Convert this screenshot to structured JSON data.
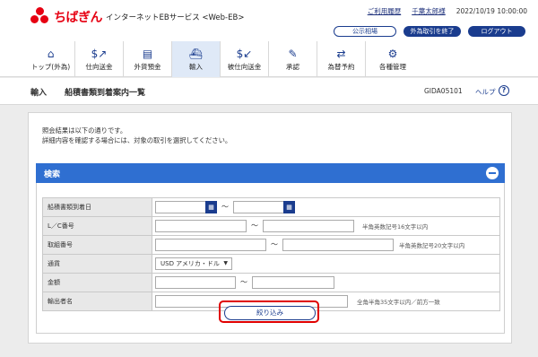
{
  "header": {
    "logo_text": "ちばぎん",
    "service_name": "インターネットEBサービス <Web-EB>",
    "usage_history_link": "ご利用履歴",
    "user_name": "千葉太郎様",
    "datetime": "2022/10/19 10:00:00",
    "buttons": {
      "public_rates": "公示相場",
      "end_fx": "外為取引を終了",
      "logout": "ログアウト"
    }
  },
  "nav": [
    {
      "label": "トップ(外為)",
      "icon": "home-icon"
    },
    {
      "label": "仕向送金",
      "icon": "remit-out-icon"
    },
    {
      "label": "外貨預金",
      "icon": "deposit-icon"
    },
    {
      "label": "輸入",
      "icon": "import-icon",
      "active": true
    },
    {
      "label": "被仕向送金",
      "icon": "remit-in-icon"
    },
    {
      "label": "承認",
      "icon": "approval-icon"
    },
    {
      "label": "為替予約",
      "icon": "fx-contract-icon"
    },
    {
      "label": "各種管理",
      "icon": "management-icon"
    }
  ],
  "title_bar": {
    "category": "輸入",
    "title": "船積書類到着案内一覧",
    "screen_code": "GIDA05101",
    "help": "ヘルプ",
    "help_icon": "?"
  },
  "message": {
    "line1": "照会結果は以下の通りです。",
    "line2": "詳細内容を確認する場合には、対象の取引を選択してください。"
  },
  "search": {
    "title": "検索",
    "fields": {
      "arrival_date": {
        "label": "船積書類到着日",
        "from": "",
        "to": "",
        "sep": "～"
      },
      "lc_number": {
        "label": "L／C番号",
        "from": "",
        "to": "",
        "sep": "～",
        "hint": "半角英数記号16文字以内"
      },
      "trade_number": {
        "label": "取組番号",
        "from": "",
        "to": "",
        "sep": "～",
        "hint": "半角英数記号20文字以内"
      },
      "currency": {
        "label": "通貨",
        "value": "USD アメリカ・ドル"
      },
      "amount": {
        "label": "金額",
        "from": "",
        "to": "",
        "sep": "～"
      },
      "exporter": {
        "label": "輸出者名",
        "value": "",
        "hint": "全角半角35文字以内／前方一致"
      }
    },
    "filter_button": "絞り込み"
  },
  "colors": {
    "brand_red": "#e60012",
    "navy": "#1a3c8e",
    "panel_blue": "#2f6fd1",
    "highlight": "#e00000"
  }
}
